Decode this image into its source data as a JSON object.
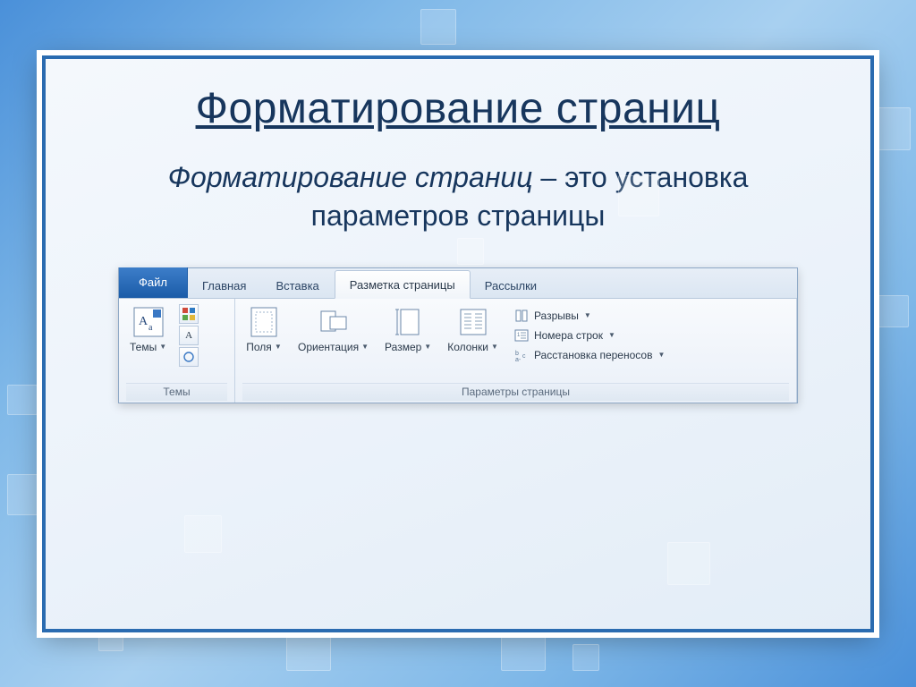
{
  "slide": {
    "title": "Форматирование страниц",
    "definition_term": "Форматирование страниц",
    "definition_rest": " – это установка параметров страницы"
  },
  "ribbon": {
    "tabs": {
      "file": "Файл",
      "home": "Главная",
      "insert": "Вставка",
      "page_layout": "Разметка страницы",
      "mailings": "Рассылки"
    },
    "groups": {
      "themes": {
        "label": "Темы",
        "themes_btn": "Темы"
      },
      "page_setup": {
        "label": "Параметры страницы",
        "margins": "Поля",
        "orientation": "Ориентация",
        "size": "Размер",
        "columns": "Колонки",
        "breaks": "Разрывы",
        "line_numbers": "Номера строк",
        "hyphenation": "Расстановка переносов"
      }
    }
  }
}
